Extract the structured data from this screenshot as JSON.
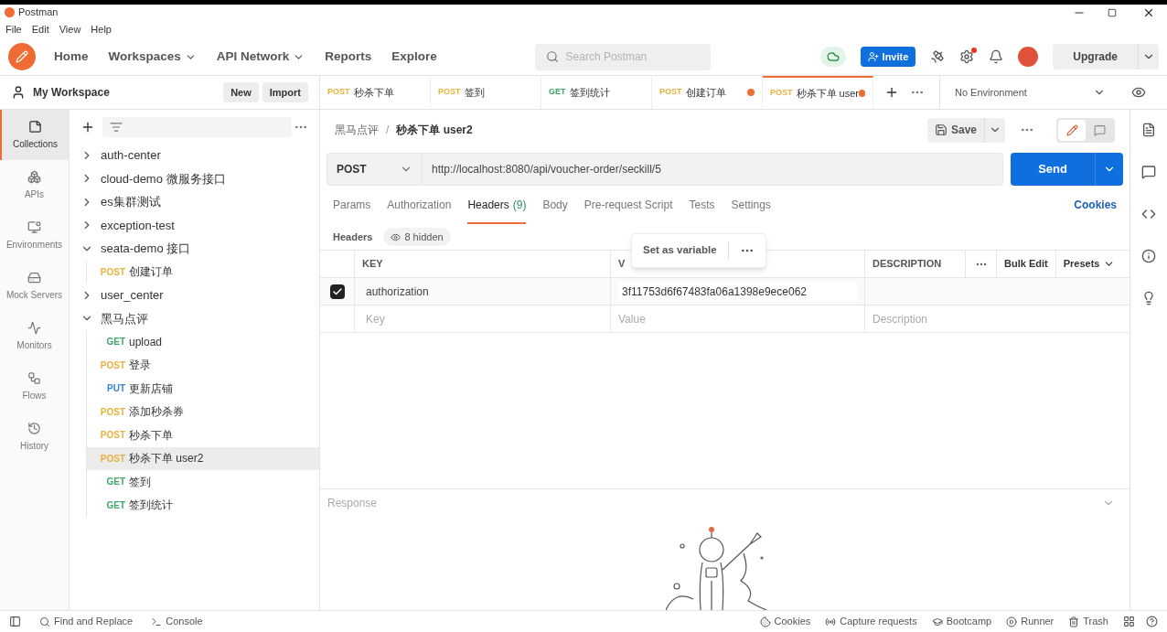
{
  "window": {
    "title": "Postman"
  },
  "menu": [
    "File",
    "Edit",
    "View",
    "Help"
  ],
  "nav": [
    {
      "label": "Home",
      "dropdown": false
    },
    {
      "label": "Workspaces",
      "dropdown": true
    },
    {
      "label": "API Network",
      "dropdown": true
    },
    {
      "label": "Reports",
      "dropdown": false
    },
    {
      "label": "Explore",
      "dropdown": false
    }
  ],
  "search": {
    "placeholder": "Search Postman"
  },
  "invite": "Invite",
  "upgrade": "Upgrade",
  "workspace": {
    "title": "My Workspace",
    "buttons": [
      "New",
      "Import"
    ]
  },
  "rail": [
    {
      "kind": "collections",
      "label": "Collections",
      "selected": true
    },
    {
      "kind": "apis",
      "label": "APIs",
      "selected": false
    },
    {
      "kind": "environments",
      "label": "Environments",
      "selected": false
    },
    {
      "kind": "mock",
      "label": "Mock Servers",
      "selected": false
    },
    {
      "kind": "monitors",
      "label": "Monitors",
      "selected": false
    },
    {
      "kind": "flows",
      "label": "Flows",
      "selected": false
    },
    {
      "kind": "history",
      "label": "History",
      "selected": false
    }
  ],
  "tree": [
    {
      "label": "auth-center",
      "expanded": false
    },
    {
      "label": "cloud-demo 微服务接口",
      "expanded": false
    },
    {
      "label": "es集群测试",
      "expanded": false
    },
    {
      "label": "exception-test",
      "expanded": false
    },
    {
      "label": "seata-demo 接口",
      "expanded": true,
      "children": [
        {
          "method": "POST",
          "color": "#e8b23c",
          "label": "创建订单",
          "selected": false
        }
      ]
    },
    {
      "label": "user_center",
      "expanded": false
    },
    {
      "label": "黑马点评",
      "expanded": true,
      "children": [
        {
          "method": "GET",
          "color": "#3fa66b",
          "label": "upload",
          "selected": false
        },
        {
          "method": "POST",
          "color": "#e8b23c",
          "label": "登录",
          "selected": false
        },
        {
          "method": "PUT",
          "color": "#3a82d6",
          "label": "更新店铺",
          "selected": false
        },
        {
          "method": "POST",
          "color": "#e8b23c",
          "label": "添加秒杀券",
          "selected": false
        },
        {
          "method": "POST",
          "color": "#e8b23c",
          "label": "秒杀下单",
          "selected": false
        },
        {
          "method": "POST",
          "color": "#e8b23c",
          "label": "秒杀下单 user2",
          "selected": true
        },
        {
          "method": "GET",
          "color": "#3fa66b",
          "label": "签到",
          "selected": false
        },
        {
          "method": "GET",
          "color": "#3fa66b",
          "label": "签到统计",
          "selected": false
        }
      ]
    }
  ],
  "tabs": [
    {
      "method": "POST",
      "color": "#e8b23c",
      "label": "秒杀下单",
      "selected": false,
      "unsaved": false
    },
    {
      "method": "POST",
      "color": "#e8b23c",
      "label": "签到",
      "selected": false,
      "unsaved": false
    },
    {
      "method": "GET",
      "color": "#3fa66b",
      "label": "签到统计",
      "selected": false,
      "unsaved": false
    },
    {
      "method": "POST",
      "color": "#e8b23c",
      "label": "创建订单",
      "selected": false,
      "unsaved": true
    },
    {
      "method": "POST",
      "color": "#e8b23c",
      "label": "秒杀下单 user",
      "selected": true,
      "unsaved": true
    }
  ],
  "environment": "No Environment",
  "breadcrumb": [
    "黑马点评",
    "秒杀下单 user2"
  ],
  "breadcrumb_separator": "/",
  "view_toggle": [
    {
      "kind": "edit",
      "selected": true
    },
    {
      "kind": "comments",
      "selected": false
    }
  ],
  "save": "Save",
  "request": {
    "method": "POST",
    "url": "http://localhost:8080/api/voucher-order/seckill/5",
    "send": "Send"
  },
  "request_tabs": [
    {
      "label": "Params",
      "selected": false
    },
    {
      "label": "Authorization",
      "selected": false
    },
    {
      "label": "Headers",
      "count": "(9)",
      "selected": true
    },
    {
      "label": "Body",
      "selected": false
    },
    {
      "label": "Pre-request Script",
      "selected": false
    },
    {
      "label": "Tests",
      "selected": false
    },
    {
      "label": "Settings",
      "selected": false
    }
  ],
  "cookies": "Cookies",
  "headers": {
    "title": "Headers",
    "hidden": "8 hidden"
  },
  "table": {
    "columns": [
      "KEY",
      "V",
      "DESCRIPTION"
    ],
    "bulk_edit": "Bulk Edit",
    "presets": "Presets",
    "rows": [
      {
        "checked": true,
        "key": "authorization",
        "value": "3f11753d6f67483fa06a1398e9ece062"
      }
    ],
    "empty_row": {
      "key": "Key",
      "value": "Value",
      "description": "Description"
    }
  },
  "popover": {
    "label": "Set as variable"
  },
  "response": {
    "title": "Response"
  },
  "status_bar": {
    "left": [
      {
        "kind": "find",
        "label": "Find and Replace"
      },
      {
        "kind": "console",
        "label": "Console"
      }
    ],
    "right": [
      {
        "kind": "cookies",
        "label": "Cookies"
      },
      {
        "kind": "capture",
        "label": "Capture requests"
      },
      {
        "kind": "bootcamp",
        "label": "Bootcamp"
      },
      {
        "kind": "runner",
        "label": "Runner"
      },
      {
        "kind": "trash",
        "label": "Trash"
      }
    ]
  }
}
